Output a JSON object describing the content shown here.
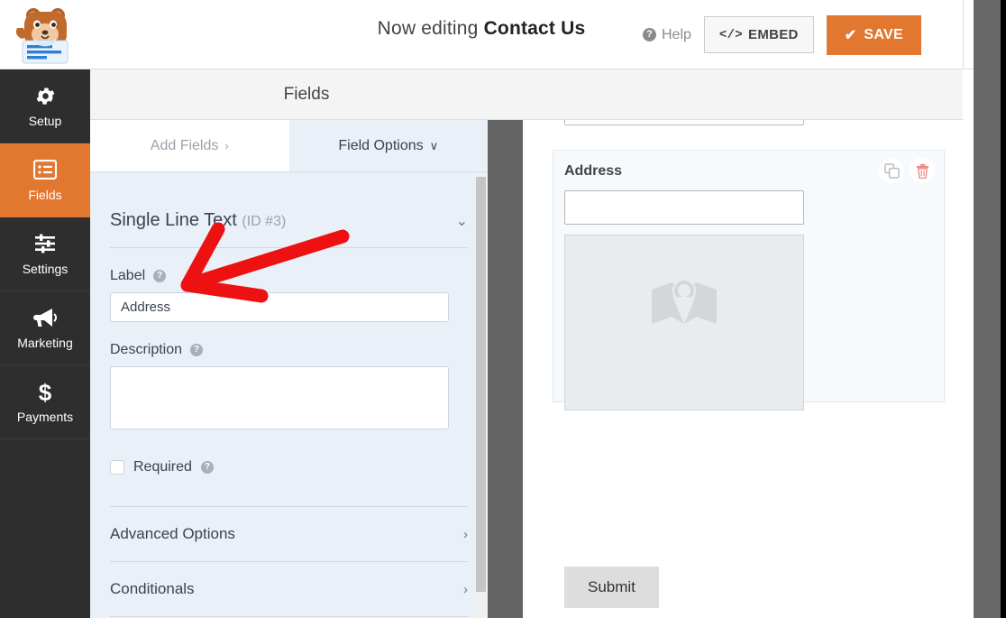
{
  "header": {
    "logo_icon": "wpforms-bear-logo",
    "now_editing_prefix": "Now editing",
    "form_name": "Contact Us",
    "help_label": "Help",
    "help_icon": "question-circle-icon",
    "embed_label": "EMBED",
    "embed_icon": "code-brackets-icon",
    "save_label": "SAVE",
    "save_icon": "checkmark-icon",
    "close_icon": "close-x-icon"
  },
  "sidebar": {
    "items": [
      {
        "label": "Setup",
        "icon": "gear-icon",
        "active": false
      },
      {
        "label": "Fields",
        "icon": "list-icon",
        "active": true
      },
      {
        "label": "Settings",
        "icon": "sliders-icon",
        "active": false
      },
      {
        "label": "Marketing",
        "icon": "megaphone-icon",
        "active": false
      },
      {
        "label": "Payments",
        "icon": "dollar-sign-icon",
        "active": false
      }
    ]
  },
  "panel_header": {
    "title": "Fields"
  },
  "tabs": [
    {
      "label": "Add Fields",
      "chevron": "›",
      "icon": "chevron-right-icon",
      "active": false
    },
    {
      "label": "Field Options",
      "chevron": "∨",
      "icon": "chevron-down-icon",
      "active": true
    }
  ],
  "field_options": {
    "field_type": "Single Line Text",
    "field_id": "(ID #3)",
    "collapse_icon": "chevron-down-icon",
    "label_section": {
      "label": "Label",
      "help_icon": "question-mark-icon",
      "value": "Address"
    },
    "description_section": {
      "label": "Description",
      "help_icon": "question-mark-icon",
      "value": ""
    },
    "required_section": {
      "label": "Required",
      "help_icon": "question-mark-icon",
      "checked": false
    },
    "accordions": [
      {
        "label": "Advanced Options",
        "icon": "chevron-right-icon",
        "chevron": "›"
      },
      {
        "label": "Conditionals",
        "icon": "chevron-right-icon",
        "chevron": "›"
      }
    ]
  },
  "preview": {
    "field_card": {
      "label": "Address",
      "duplicate_icon": "duplicate-icon",
      "delete_icon": "trash-icon",
      "map_placeholder_icon": "map-pin-icon",
      "input_value": ""
    },
    "submit_label": "Submit"
  },
  "annotation": {
    "type": "red-arrow",
    "color": "#ee1111",
    "points_to": "Label field"
  },
  "colors": {
    "brand_orange": "#e27730",
    "sidebar_dark": "#2e2e2e",
    "panel_blue": "#e9f0f8",
    "splitter_gray": "#646464",
    "card_bg": "#f7fafd",
    "submit_gray": "#dddddd",
    "annotation_red": "#ee1111"
  }
}
